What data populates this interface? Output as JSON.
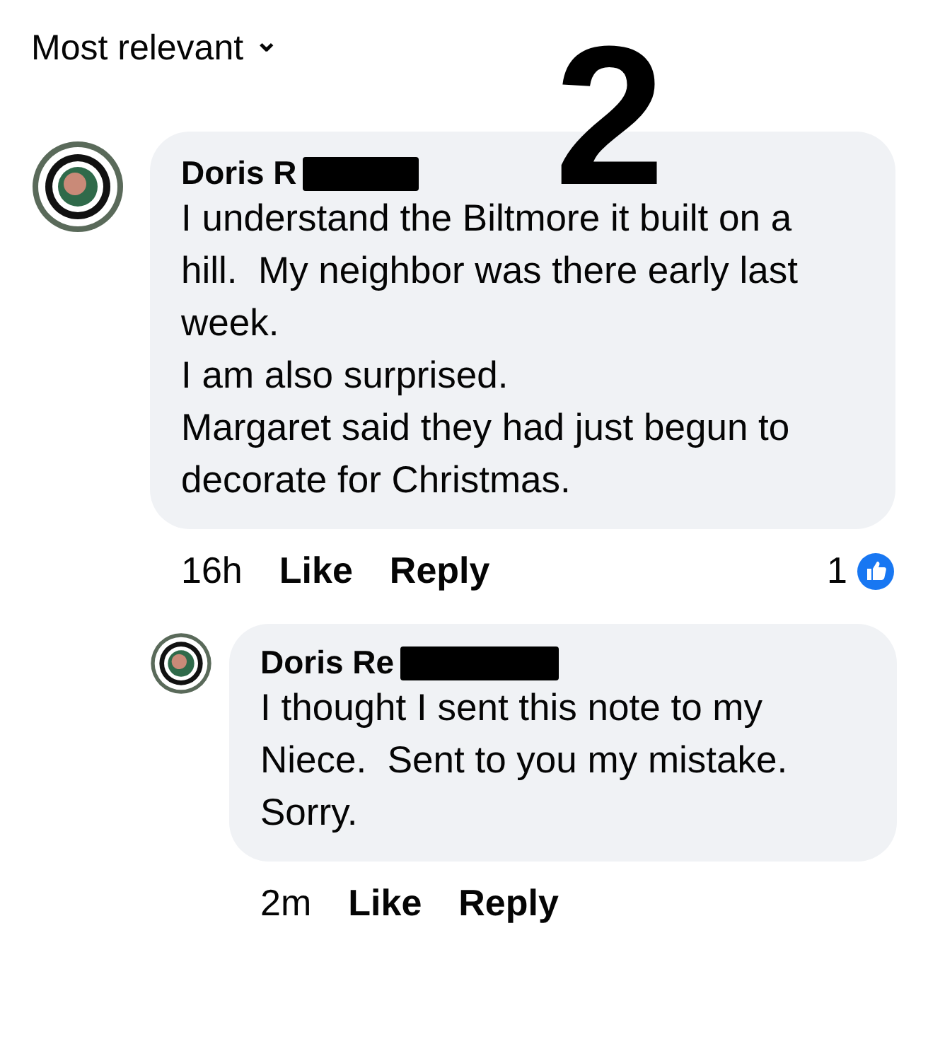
{
  "sort": {
    "label": "Most relevant",
    "caret": "⌄"
  },
  "annotation": "2",
  "comments": [
    {
      "author": "Doris R",
      "redacted": true,
      "paragraphs": [
        "I understand the Biltmore it built on a hill.  My neighbor was there early last week.",
        "I am also surprised.",
        "Margaret said they had just begun to decorate for Christmas."
      ],
      "time": "16h",
      "actions": [
        "Like",
        "Reply"
      ],
      "reactions": "1",
      "reply": false
    },
    {
      "author": "Doris Re",
      "redacted": true,
      "paragraphs": [
        "I thought I sent this note to my",
        "Niece.  Sent to you my mistake.  Sorry."
      ],
      "time": "2m",
      "actions": [
        "Like",
        "Reply"
      ],
      "reply": true
    }
  ]
}
